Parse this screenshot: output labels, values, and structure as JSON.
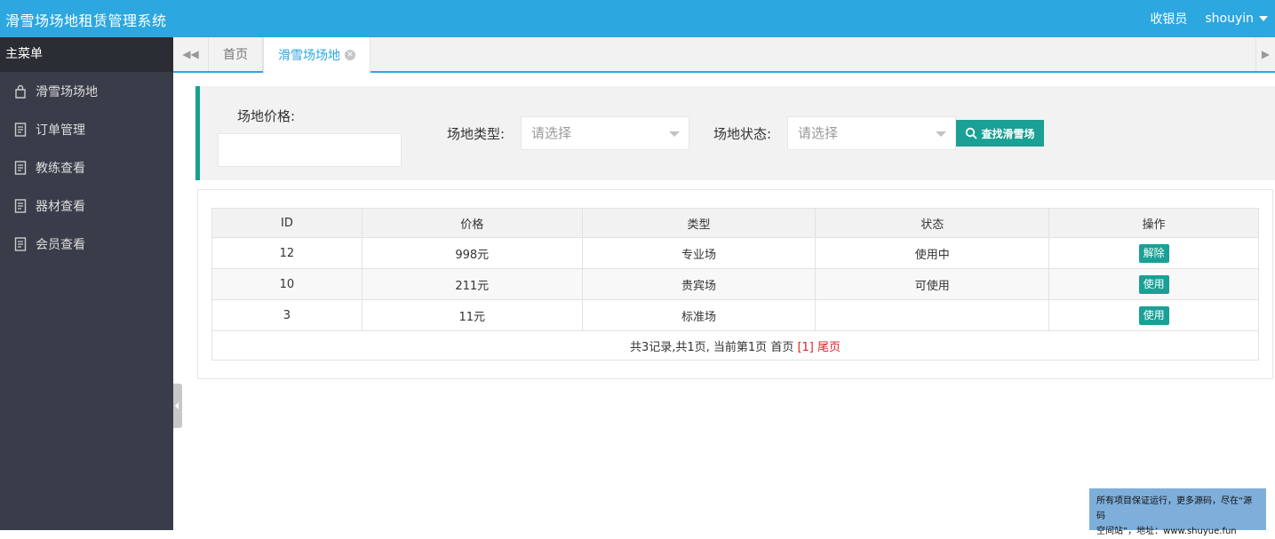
{
  "header": {
    "app_title": "滑雪场场地租赁管理系统",
    "role": "收银员",
    "username": "shouyin"
  },
  "sidebar": {
    "title": "主菜单",
    "items": [
      {
        "label": "滑雪场场地",
        "icon": "bag-icon"
      },
      {
        "label": "订单管理",
        "icon": "document-icon"
      },
      {
        "label": "教练查看",
        "icon": "document-icon"
      },
      {
        "label": "器材查看",
        "icon": "document-icon"
      },
      {
        "label": "会员查看",
        "icon": "document-icon"
      }
    ]
  },
  "tabs": {
    "items": [
      {
        "label": "首页"
      },
      {
        "label": "滑雪场场地"
      }
    ],
    "active_index": 1
  },
  "search": {
    "price_label": "场地价格:",
    "price_value": "",
    "type_label": "场地类型:",
    "type_placeholder": "请选择",
    "status_label": "场地状态:",
    "status_placeholder": "请选择",
    "button_label": "查找滑雪场"
  },
  "table": {
    "columns": [
      "ID",
      "价格",
      "类型",
      "状态",
      "操作"
    ],
    "rows": [
      {
        "id": "12",
        "price": "998元",
        "type": "专业场",
        "status": "使用中",
        "action": "解除"
      },
      {
        "id": "10",
        "price": "211元",
        "type": "贵宾场",
        "status": "可使用",
        "action": "使用"
      },
      {
        "id": "3",
        "price": "11元",
        "type": "标准场",
        "status": "",
        "action": "使用"
      }
    ],
    "pager": {
      "summary": "共3记录,共1页, 当前第1页",
      "first": "首页",
      "current": "[1]",
      "last": "尾页"
    }
  },
  "watermark": {
    "line1": "所有项目保证运行，更多源码，尽在“源码",
    "line2": "空间站”，地址：www.shuyue.fun"
  },
  "colors": {
    "header_bg": "#2ca7e0",
    "sidebar_bg": "#393d49",
    "accent": "#1aa094",
    "pager_link": "#e02020"
  }
}
